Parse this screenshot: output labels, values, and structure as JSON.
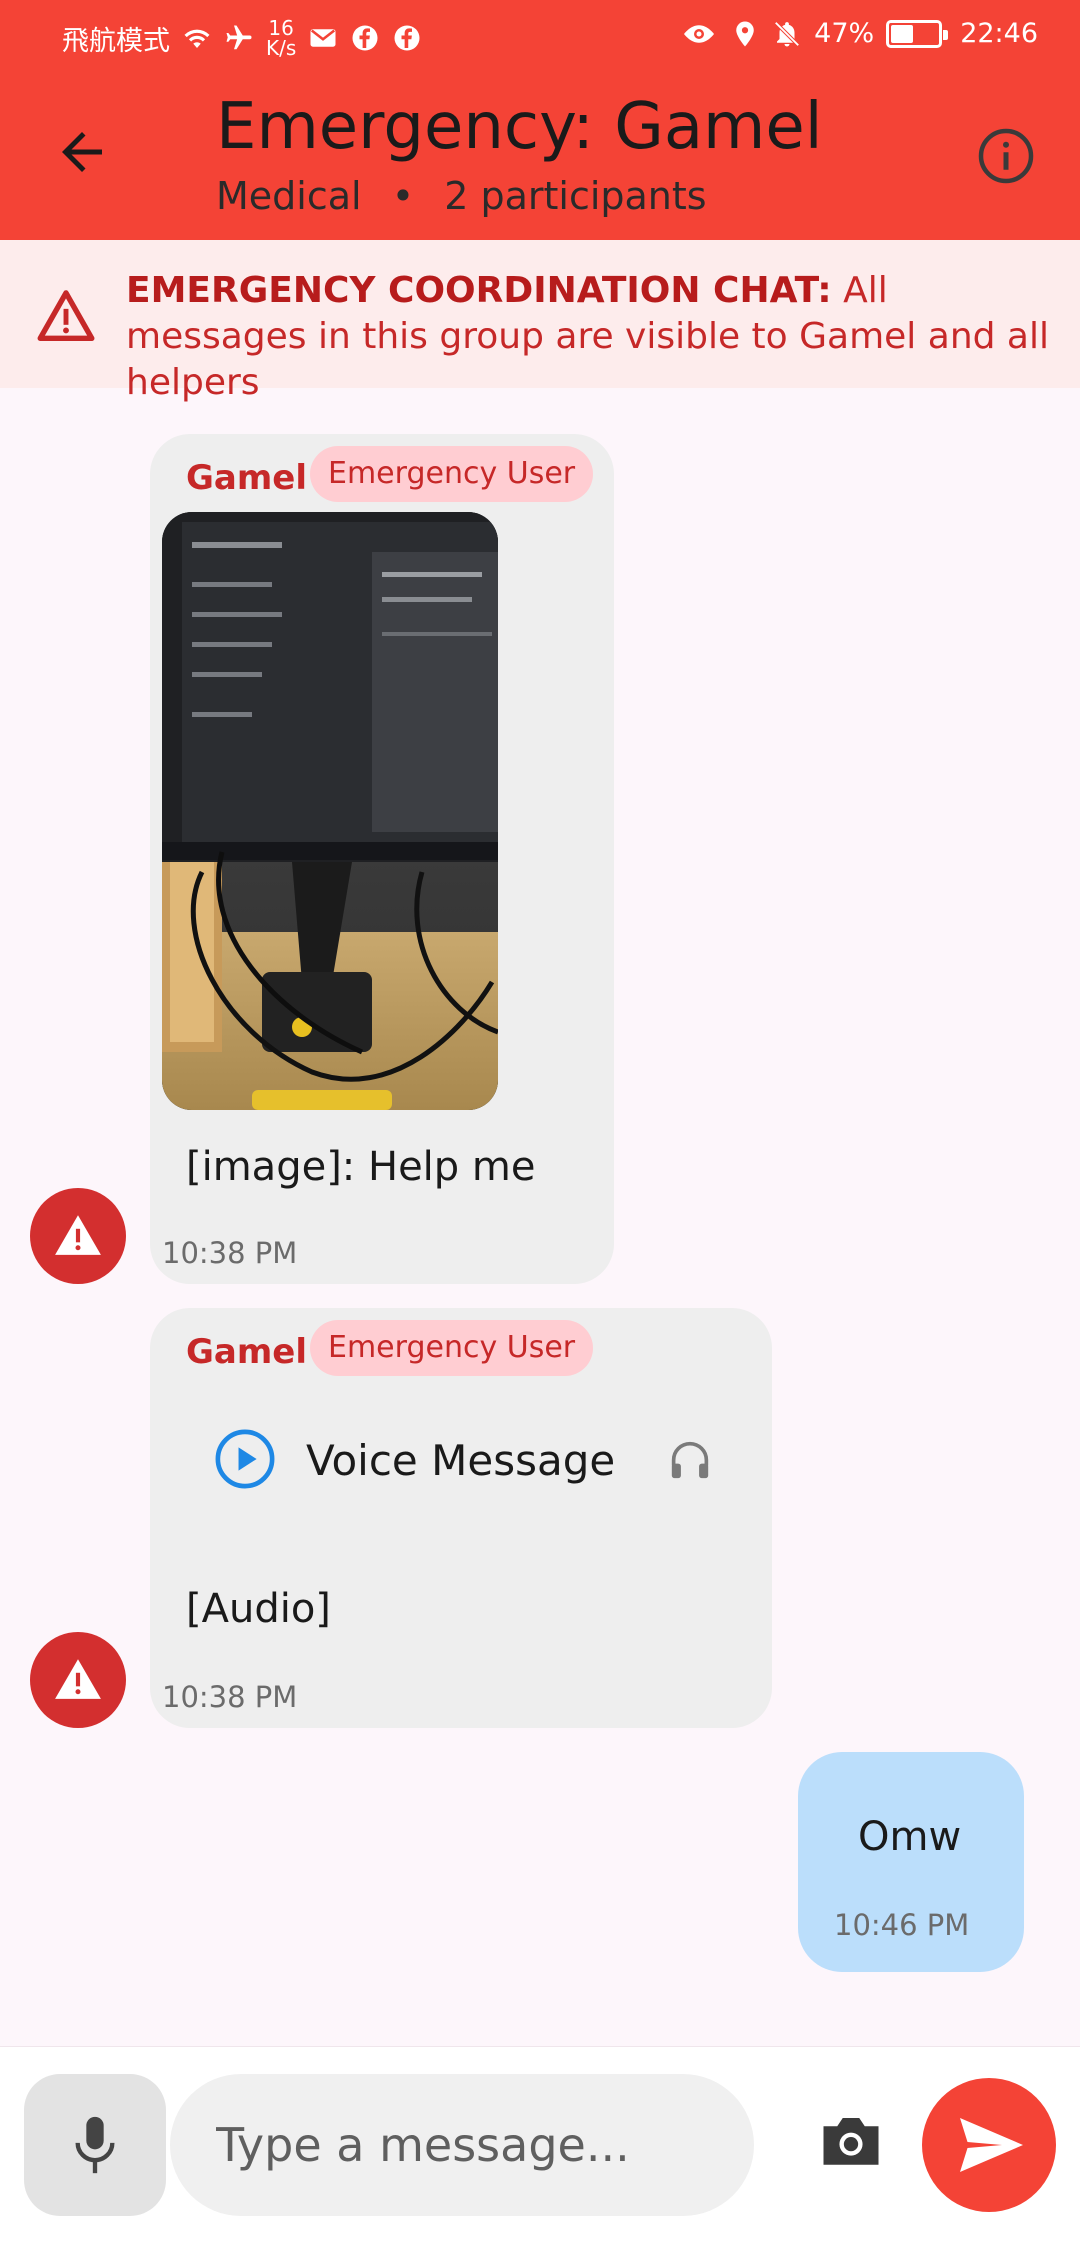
{
  "status_bar": {
    "left_label": "飛航模式",
    "speed_value": "16",
    "speed_unit": "K/s",
    "battery": "47%",
    "battery_level": 0.47,
    "time": "22:46"
  },
  "header": {
    "title": "Emergency: Gamel",
    "category": "Medical",
    "separator": "•",
    "participants": "2 participants",
    "color": "#f44336"
  },
  "banner": {
    "bold": "EMERGENCY COORDINATION CHAT:",
    "text": " All messages in this group are visible to Gamel and all helpers"
  },
  "messages": [
    {
      "sender": "Gamel",
      "badge": "Emergency User",
      "text": "[image]: Help me",
      "time": "10:38 PM"
    },
    {
      "sender": "Gamel",
      "badge": "Emergency User",
      "voice_label": "Voice Message",
      "text": "[Audio]",
      "time": "10:38 PM"
    },
    {
      "text": "Omw",
      "time": "10:46 PM"
    }
  ],
  "composer": {
    "placeholder": "Type a message..."
  },
  "icons": {
    "back": "arrow-left-icon",
    "info": "info-icon",
    "warning": "warning-triangle-icon",
    "play": "play-circle-icon",
    "headphones": "headphones-icon",
    "mic": "mic-icon",
    "camera": "camera-icon",
    "send": "send-icon"
  }
}
